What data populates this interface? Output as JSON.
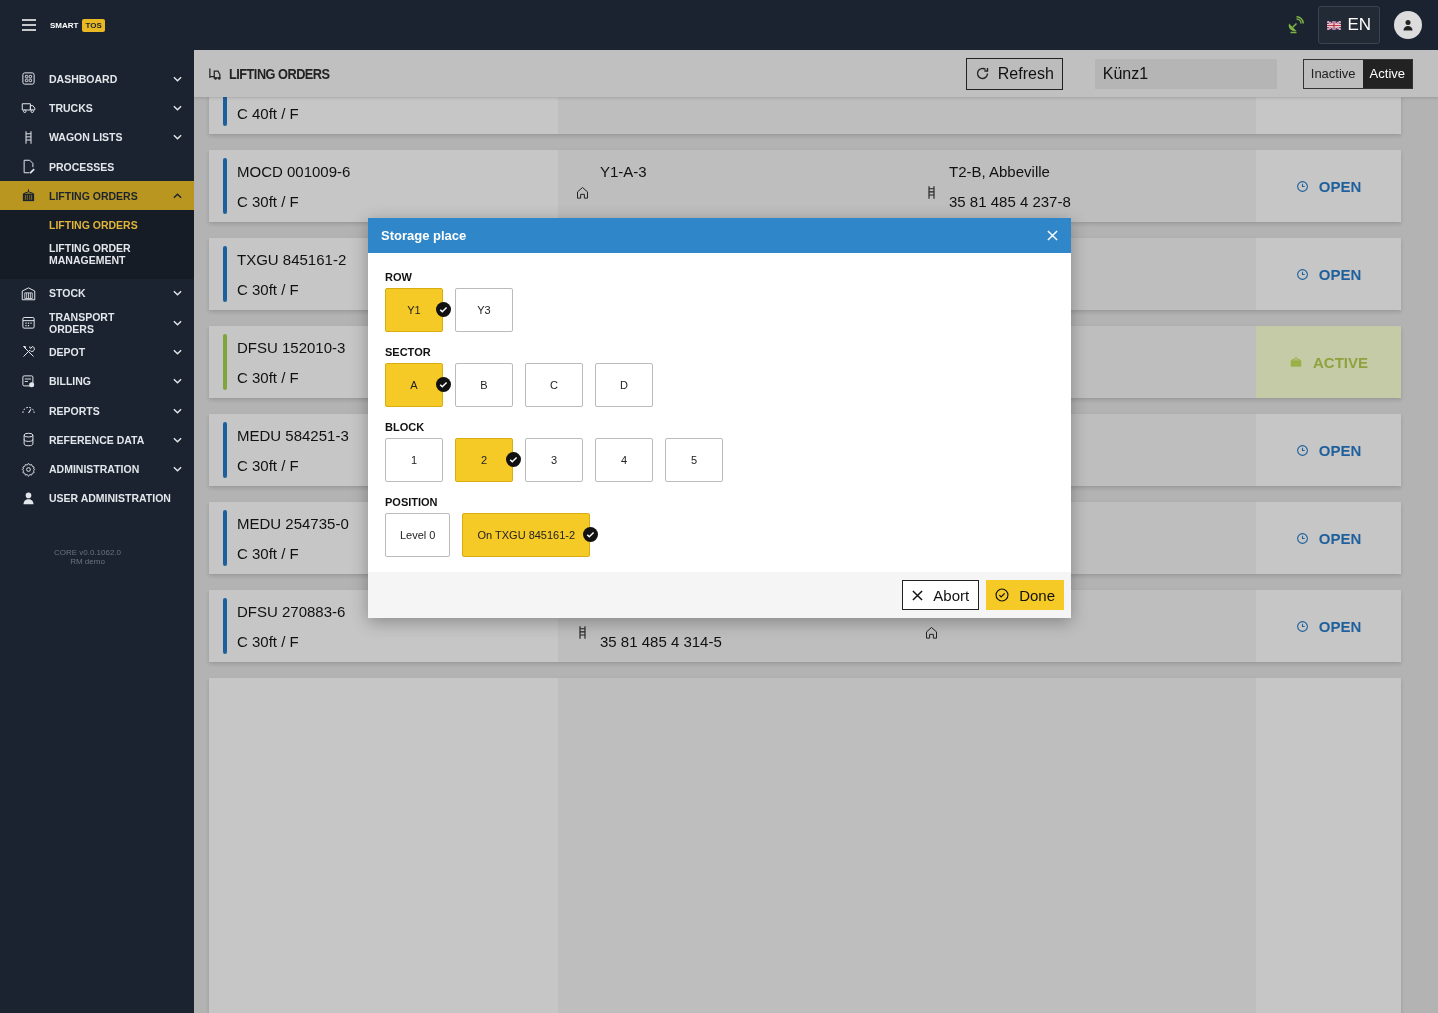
{
  "topbar": {
    "brand": "SMART",
    "brand_badge": "TOS",
    "language": "EN"
  },
  "sidebar": {
    "items": [
      {
        "label": "DASHBOARD",
        "kind": "grid",
        "expandable": true,
        "expanded": false,
        "selected": false
      },
      {
        "label": "TRUCKS",
        "kind": "truck",
        "expandable": true,
        "expanded": false,
        "selected": false
      },
      {
        "label": "WAGON LISTS",
        "kind": "track",
        "expandable": true,
        "expanded": false,
        "selected": false
      },
      {
        "label": "PROCESSES",
        "kind": "doc",
        "expandable": false,
        "selected": false
      },
      {
        "label": "LIFTING ORDERS",
        "kind": "container",
        "expandable": true,
        "expanded": true,
        "selected": true,
        "children": [
          {
            "label": "LIFTING ORDERS",
            "selected": true
          },
          {
            "label": "LIFTING ORDER MANAGEMENT",
            "selected": false
          }
        ]
      },
      {
        "label": "STOCK",
        "kind": "warehouse",
        "expandable": true,
        "expanded": false,
        "selected": false
      },
      {
        "label": "TRANSPORT ORDERS",
        "kind": "calendar",
        "expandable": true,
        "expanded": false,
        "selected": false
      },
      {
        "label": "DEPOT",
        "kind": "tools",
        "expandable": true,
        "expanded": false,
        "selected": false
      },
      {
        "label": "BILLING",
        "kind": "invoice",
        "expandable": true,
        "expanded": false,
        "selected": false
      },
      {
        "label": "REPORTS",
        "kind": "gauge",
        "expandable": true,
        "expanded": false,
        "selected": false
      },
      {
        "label": "REFERENCE DATA",
        "kind": "database",
        "expandable": true,
        "expanded": false,
        "selected": false
      },
      {
        "label": "ADMINISTRATION",
        "kind": "gear",
        "expandable": true,
        "expanded": false,
        "selected": false
      },
      {
        "label": "USER ADMINISTRATION",
        "kind": "user",
        "expandable": false,
        "selected": false
      }
    ],
    "version": "CORE v0.0.1062.0",
    "environment": "RM demo"
  },
  "page": {
    "title": "LIFTING ORDERS",
    "refresh": "Refresh",
    "search_value": "Künz1",
    "filter": [
      {
        "label": "Inactive",
        "selected": false
      },
      {
        "label": "Active",
        "selected": true
      }
    ]
  },
  "orders": [
    {
      "type": "C 40ft / F",
      "color": "#1c5f9c"
    },
    {
      "container": "MOCD 001009-6",
      "type": "C 30ft / F",
      "color": "#1c5f9c",
      "location": {
        "kind": "house",
        "line_1": "Y1-A-3"
      },
      "destination": {
        "kind": "wagon",
        "line_1": "T2-B, Abbeville",
        "line_2": "35 81 485 4 237-8"
      },
      "status": "OPEN",
      "kind": "open"
    },
    {
      "container": "TXGU 845161-2",
      "type": "C 30ft / F",
      "color": "#1c5f9c",
      "status": "OPEN",
      "kind": "open"
    },
    {
      "container": "DFSU 152010-3",
      "type": "C 30ft / F",
      "color": "#7fa53c",
      "status": "ACTIVE",
      "kind": "active"
    },
    {
      "container": "MEDU 584251-3",
      "type": "C 30ft / F",
      "color": "#1c5f9c",
      "status": "OPEN",
      "kind": "open"
    },
    {
      "container": "MEDU 254735-0",
      "type": "C 30ft / F",
      "color": "#1c5f9c",
      "status": "OPEN",
      "kind": "open"
    },
    {
      "container": "DFSU 270883-6",
      "type": "C 30ft / F",
      "color": "#1c5f9c",
      "location": {
        "kind": "wagon",
        "line_2": "35 81 485 4 314-5"
      },
      "destination": {
        "kind": "house"
      },
      "status": "OPEN",
      "kind": "open"
    }
  ],
  "dialog": {
    "title": "Storage place",
    "groups": [
      {
        "label": "ROW",
        "options": [
          {
            "label": "Y1",
            "selected": true
          },
          {
            "label": "Y3",
            "selected": false
          }
        ]
      },
      {
        "label": "SECTOR",
        "options": [
          {
            "label": "A",
            "selected": true
          },
          {
            "label": "B",
            "selected": false
          },
          {
            "label": "C",
            "selected": false
          },
          {
            "label": "D",
            "selected": false
          }
        ]
      },
      {
        "label": "BLOCK",
        "options": [
          {
            "label": "1",
            "selected": false
          },
          {
            "label": "2",
            "selected": true
          },
          {
            "label": "3",
            "selected": false
          },
          {
            "label": "4",
            "selected": false
          },
          {
            "label": "5",
            "selected": false
          }
        ]
      },
      {
        "label": "POSITION",
        "options": [
          {
            "label": "Level 0",
            "selected": false
          },
          {
            "label": "On TXGU 845161-2",
            "selected": true
          }
        ]
      }
    ],
    "abort": "Abort",
    "done": "Done"
  }
}
